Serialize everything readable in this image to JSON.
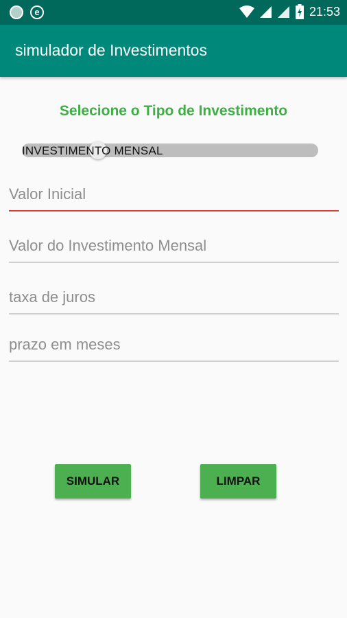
{
  "status_bar": {
    "time": "21:53",
    "left_icons": [
      "circle-notification-icon",
      "e-notification-icon"
    ],
    "right_icons": [
      "wifi-icon",
      "signal-icon",
      "signal-icon",
      "battery-charging-icon"
    ]
  },
  "toolbar": {
    "title": "simulador de Investimentos"
  },
  "main": {
    "heading": "Selecione o Tipo de Investimento",
    "switch": {
      "label": "INVESTIMENTO MENSAL",
      "checked": false
    },
    "fields": [
      {
        "placeholder": "Valor Inicial",
        "value": ""
      },
      {
        "placeholder": "Valor do Investimento Mensal",
        "value": ""
      },
      {
        "placeholder": "taxa de juros",
        "value": ""
      },
      {
        "placeholder": "prazo em meses",
        "value": ""
      }
    ],
    "buttons": {
      "simulate": "SIMULAR",
      "clear": "LIMPAR"
    }
  },
  "colors": {
    "status_bar": "#00695c",
    "toolbar": "#00897b",
    "heading": "#3db043",
    "button": "#4caf50",
    "focus_underline": "#e53935"
  }
}
